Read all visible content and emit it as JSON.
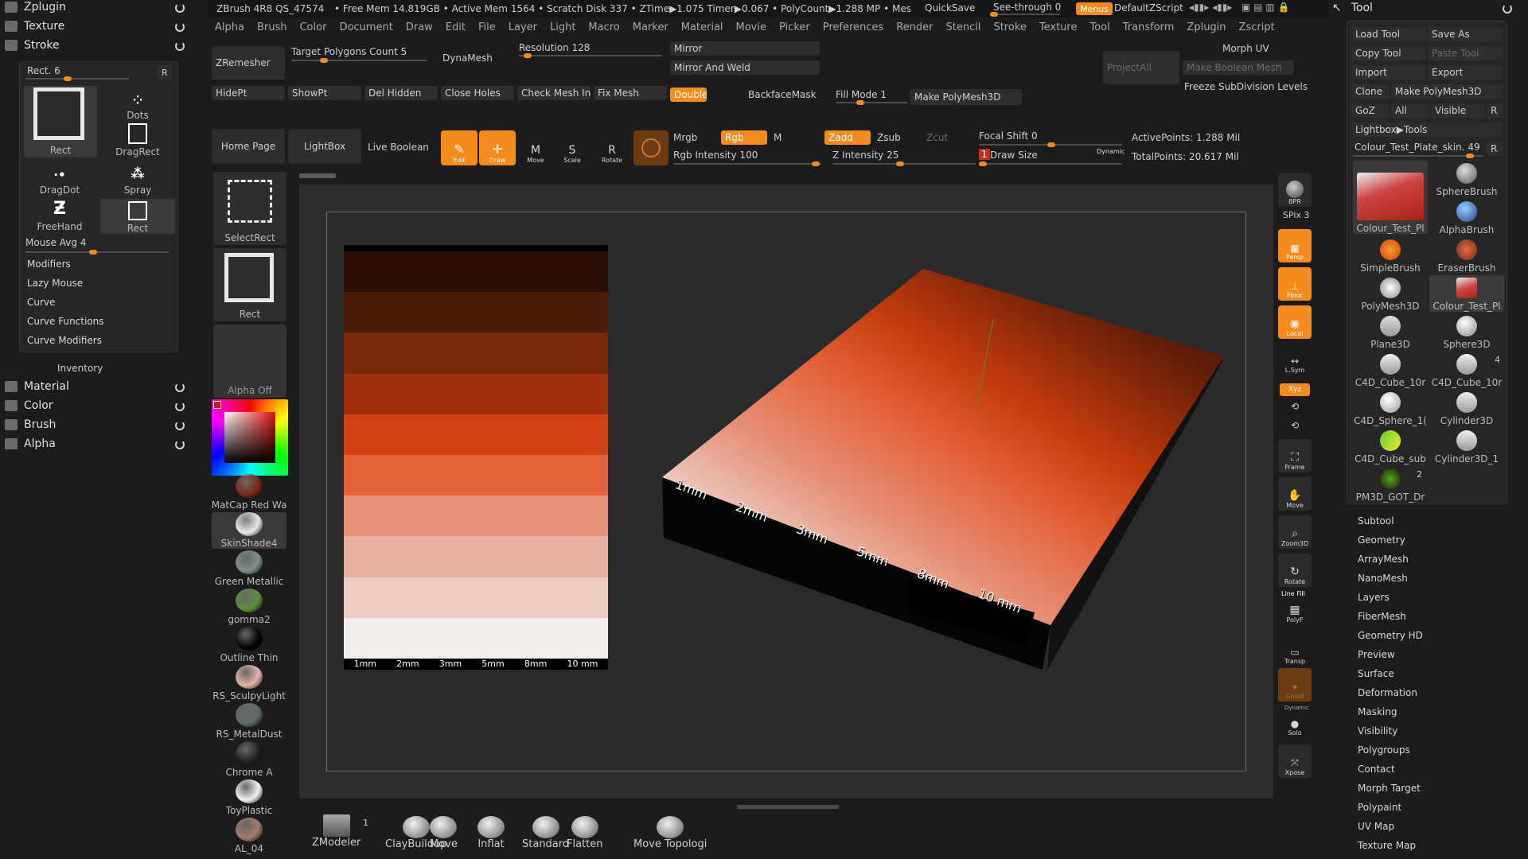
{
  "top_bar": {
    "app_title": "ZBrush 4R8 QS_47574",
    "stats": "• Free Mem 14.819GB • Active Mem 1564 • Scratch Disk 337 • ZTime▶1.075 Timer▶0.067 • PolyCount▶1.288 MP • Mes",
    "quicksave": "QuickSave",
    "see_through": "See-through  0",
    "menus": "Menus",
    "default_zscript": "DefaultZScript"
  },
  "menubar": [
    "Alpha",
    "Brush",
    "Color",
    "Document",
    "Draw",
    "Edit",
    "File",
    "Layer",
    "Light",
    "Macro",
    "Marker",
    "Material",
    "Movie",
    "Picker",
    "Preferences",
    "Render",
    "Stencil",
    "Stroke",
    "Texture",
    "Tool",
    "Transform",
    "Zplugin",
    "Zscript"
  ],
  "left_palettes": {
    "zplugin": "Zplugin",
    "texture": "Texture",
    "stroke": "Stroke",
    "inventory": "Inventory",
    "material": "Material",
    "color": "Color",
    "brush": "Brush",
    "alpha": "Alpha"
  },
  "stroke_panel": {
    "title": "Rect. 6",
    "r": "R",
    "types": [
      "Rect",
      "Dots",
      "DragRect",
      "DragDot",
      "Spray",
      "FreeHand",
      "Rect"
    ],
    "mouse_avg": "Mouse Avg 4",
    "submenus": [
      "Modifiers",
      "Lazy Mouse",
      "Curve",
      "Curve Functions",
      "Curve Modifiers"
    ]
  },
  "geometry_bar": {
    "zremesher": "ZRemesher",
    "target_polys": "Target Polygons Count 5",
    "dynamesh": "DynaMesh",
    "resolution": "Resolution 128",
    "mirror": "Mirror",
    "mirror_weld": "Mirror And Weld",
    "morph_uv": "Morph UV",
    "projectall": "ProjectAll",
    "make_boolean": "Make Boolean Mesh",
    "freeze_subdiv": "Freeze SubDivision Levels",
    "hidept": "HidePt",
    "showpt": "ShowPt",
    "del_hidden": "Del Hidden",
    "close_holes": "Close Holes",
    "check_mesh": "Check Mesh Int",
    "fix_mesh": "Fix Mesh",
    "double": "Double",
    "backfacemask": "BackfaceMask",
    "fill_mode": "Fill Mode 1",
    "make_polymesh": "Make PolyMesh3D"
  },
  "draw_bar": {
    "home_page": "Home Page",
    "lightbox": "LightBox",
    "live_boolean": "Live Boolean",
    "edit": "Edit",
    "draw": "Draw",
    "move": "Move",
    "scale": "Scale",
    "rotate": "Rotate",
    "mrgb": "Mrgb",
    "rgb": "Rgb",
    "m": "M",
    "rgb_intensity": "Rgb Intensity 100",
    "zadd": "Zadd",
    "zsub": "Zsub",
    "zcut": "Zcut",
    "z_intensity": "Z Intensity 25",
    "focal_shift": "Focal Shift 0",
    "draw_size": "Draw Size",
    "draw_size_val": "1",
    "dynamic": "Dynamic",
    "active_points": "ActivePoints: 1.288 Mil",
    "total_points": "TotalPoints: 20.617 Mil"
  },
  "left_shelf": {
    "select_rect": "SelectRect",
    "rect": "Rect",
    "alpha_off": "Alpha Off",
    "materials": [
      {
        "name": "MatCap Red Wa",
        "color": "#7a2a1a"
      },
      {
        "name": "SkinShade4",
        "color": "#e8e8e8"
      },
      {
        "name": "Green Metallic",
        "color": "#7d8f8a"
      },
      {
        "name": "gomma2",
        "color": "#5a8f3a"
      },
      {
        "name": "Outline Thin",
        "color": "#050505"
      },
      {
        "name": "RS_SculpyLight",
        "color": "#e4b4a8"
      },
      {
        "name": "RS_MetalDust",
        "color": "#5f6a68"
      },
      {
        "name": "Chrome A",
        "color": "#222222"
      },
      {
        "name": "ToyPlastic",
        "color": "#f0f0f0"
      },
      {
        "name": "AL_04",
        "color": "#a47a68"
      }
    ]
  },
  "canvas": {
    "swatches": [
      "#2a0d05",
      "#4a1a08",
      "#7a2a0a",
      "#a03010",
      "#d04010",
      "#e4623a",
      "#e6927a",
      "#e8aea0",
      "#ecccc0",
      "#f2eeec"
    ],
    "labels": [
      "1mm",
      "2mm",
      "3mm",
      "5mm",
      "8mm",
      "10 mm"
    ]
  },
  "right_shelf": {
    "bpr": "BPR",
    "spix": "SPix 3",
    "persp": "Persp",
    "floor": "Floor",
    "local": "Local",
    "lsym": "L.Sym",
    "xyz": "Xyz",
    "frame": "Frame",
    "move": "Move",
    "zoom3d": "Zoom3D",
    "rotate": "Rotate",
    "polyf": "PolyF",
    "linefill": "Line Fill",
    "transp": "Transp",
    "ghost": "Ghost",
    "solo": "Solo",
    "dynamic": "Dynamic",
    "xpose": "Xpose"
  },
  "tool_panel": {
    "title": "Tool",
    "load_tool": "Load Tool",
    "save_as": "Save As",
    "copy_tool": "Copy Tool",
    "paste_tool": "Paste Tool",
    "import": "Import",
    "export": "Export",
    "clone": "Clone",
    "make_polymesh": "Make PolyMesh3D",
    "goz": "GoZ",
    "all": "All",
    "visible": "Visible",
    "r": "R",
    "lightbox_tools": "Lightbox▶Tools",
    "current_tool": "Colour_Test_Plate_skin. 49",
    "tools": [
      {
        "name": "Colour_Test_Pl"
      },
      {
        "name": "SphereBrush"
      },
      {
        "name": "AlphaBrush"
      },
      {
        "name": "SimpleBrush"
      },
      {
        "name": "EraserBrush"
      },
      {
        "name": "PolyMesh3D"
      },
      {
        "name": "Colour_Test_Pl"
      },
      {
        "name": "Plane3D"
      },
      {
        "name": "Sphere3D"
      },
      {
        "name": "C4D_Cube_10r"
      },
      {
        "name": "C4D_Cube_10r"
      },
      {
        "name": "C4D_Sphere_1("
      },
      {
        "name": "Cylinder3D"
      },
      {
        "name": "C4D_Cube_sub"
      },
      {
        "name": "Cylinder3D_1"
      },
      {
        "name": "PM3D_GOT_Dr"
      }
    ],
    "count_4": "4",
    "count_2": "2",
    "submenus": [
      "Subtool",
      "Geometry",
      "ArrayMesh",
      "NanoMesh",
      "Layers",
      "FiberMesh",
      "Geometry HD",
      "Preview",
      "Surface",
      "Deformation",
      "Masking",
      "Visibility",
      "Polygroups",
      "Contact",
      "Morph Target",
      "Polypaint",
      "UV Map",
      "Texture Map"
    ]
  },
  "bottom_shelf": {
    "zmodeler": "ZModeler",
    "zmodeler_count": "1",
    "brushes": [
      "ClayBuildup",
      "Move",
      "Inflat",
      "Standard",
      "Flatten",
      "Move Topologi"
    ]
  }
}
